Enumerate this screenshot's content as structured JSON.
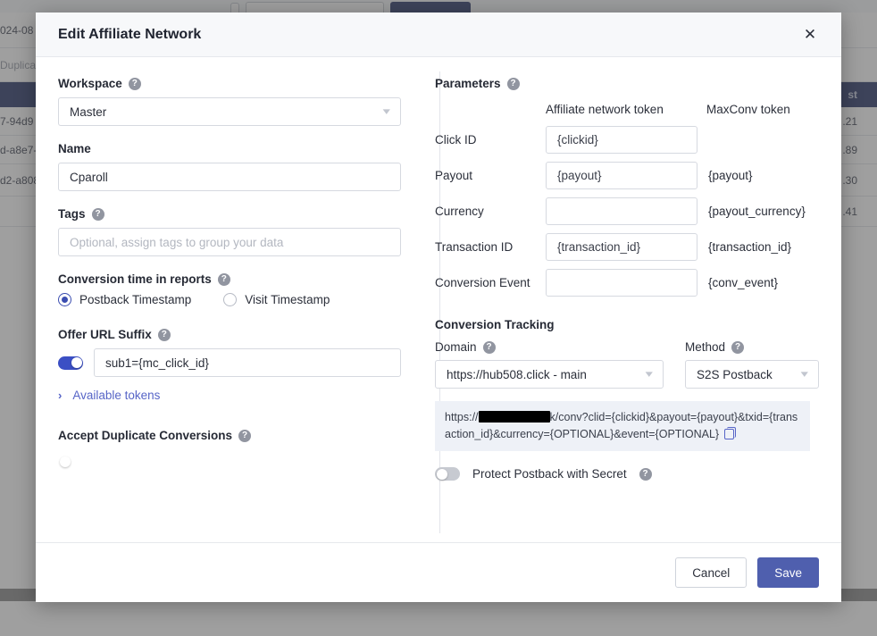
{
  "background": {
    "table_header_label": "st",
    "rows": [
      {
        "left": "024-08",
        "right": ""
      },
      {
        "left": "Duplicat",
        "right": "",
        "muted": true
      },
      {
        "left": "",
        "right": "",
        "header": true
      },
      {
        "left": "7-94d9",
        "right": ".21"
      },
      {
        "left": "d-a8e7-",
        "right": ".89"
      },
      {
        "left": "d2-a808",
        "right": ".30"
      },
      {
        "left": "",
        "right": ".41"
      }
    ]
  },
  "modal": {
    "title": "Edit Affiliate Network",
    "close_label": "✕",
    "left": {
      "workspace": {
        "label": "Workspace",
        "help": "?",
        "value": "Master"
      },
      "name": {
        "label": "Name",
        "value": "Cparoll"
      },
      "tags": {
        "label": "Tags",
        "help": "?",
        "placeholder": "Optional, assign tags to group your data",
        "value": ""
      },
      "conversion_time": {
        "label": "Conversion time in reports",
        "help": "?",
        "options": [
          {
            "label": "Postback Timestamp",
            "selected": true
          },
          {
            "label": "Visit Timestamp",
            "selected": false
          }
        ]
      },
      "offer_url_suffix": {
        "label": "Offer URL Suffix",
        "help": "?",
        "toggle_on": true,
        "value": "sub1={mc_click_id}",
        "tokens_chevron": "›",
        "tokens_link": "Available tokens"
      },
      "accept_duplicate": {
        "label": "Accept Duplicate Conversions",
        "help": "?",
        "toggle_on": false
      }
    },
    "right": {
      "parameters": {
        "label": "Parameters",
        "help": "?",
        "col_affiliate": "Affiliate network token",
        "col_maxconv": "MaxConv token",
        "rows": [
          {
            "label": "Click ID",
            "affiliate_token": "{clickid}",
            "maxconv_token": ""
          },
          {
            "label": "Payout",
            "affiliate_token": "{payout}",
            "maxconv_token": "{payout}"
          },
          {
            "label": "Currency",
            "affiliate_token": "",
            "maxconv_token": "{payout_currency}"
          },
          {
            "label": "Transaction ID",
            "affiliate_token": "{transaction_id}",
            "maxconv_token": "{transaction_id}"
          },
          {
            "label": "Conversion Event",
            "affiliate_token": "",
            "maxconv_token": "{conv_event}"
          }
        ]
      },
      "conversion_tracking": {
        "title": "Conversion Tracking",
        "domain_label": "Domain",
        "domain_help": "?",
        "domain_value": "https://hub508.click - main",
        "method_label": "Method",
        "method_help": "?",
        "method_value": "S2S Postback",
        "postback_url_prefix": "https://",
        "postback_url_suffix": "k/conv?clid={clickid}&payout={payout}&txid={transaction_id}&currency={OPTIONAL}&event={OPTIONAL}",
        "copy_icon": "copy-icon",
        "protect_label": "Protect Postback with Secret",
        "protect_help": "?",
        "protect_toggle_on": false
      }
    },
    "footer": {
      "cancel_label": "Cancel",
      "save_label": "Save"
    }
  },
  "colors": {
    "accent": "#4f5fae",
    "toggle_on": "#3b4fc4",
    "link": "#5765c7",
    "bg_header": "#33406f"
  }
}
